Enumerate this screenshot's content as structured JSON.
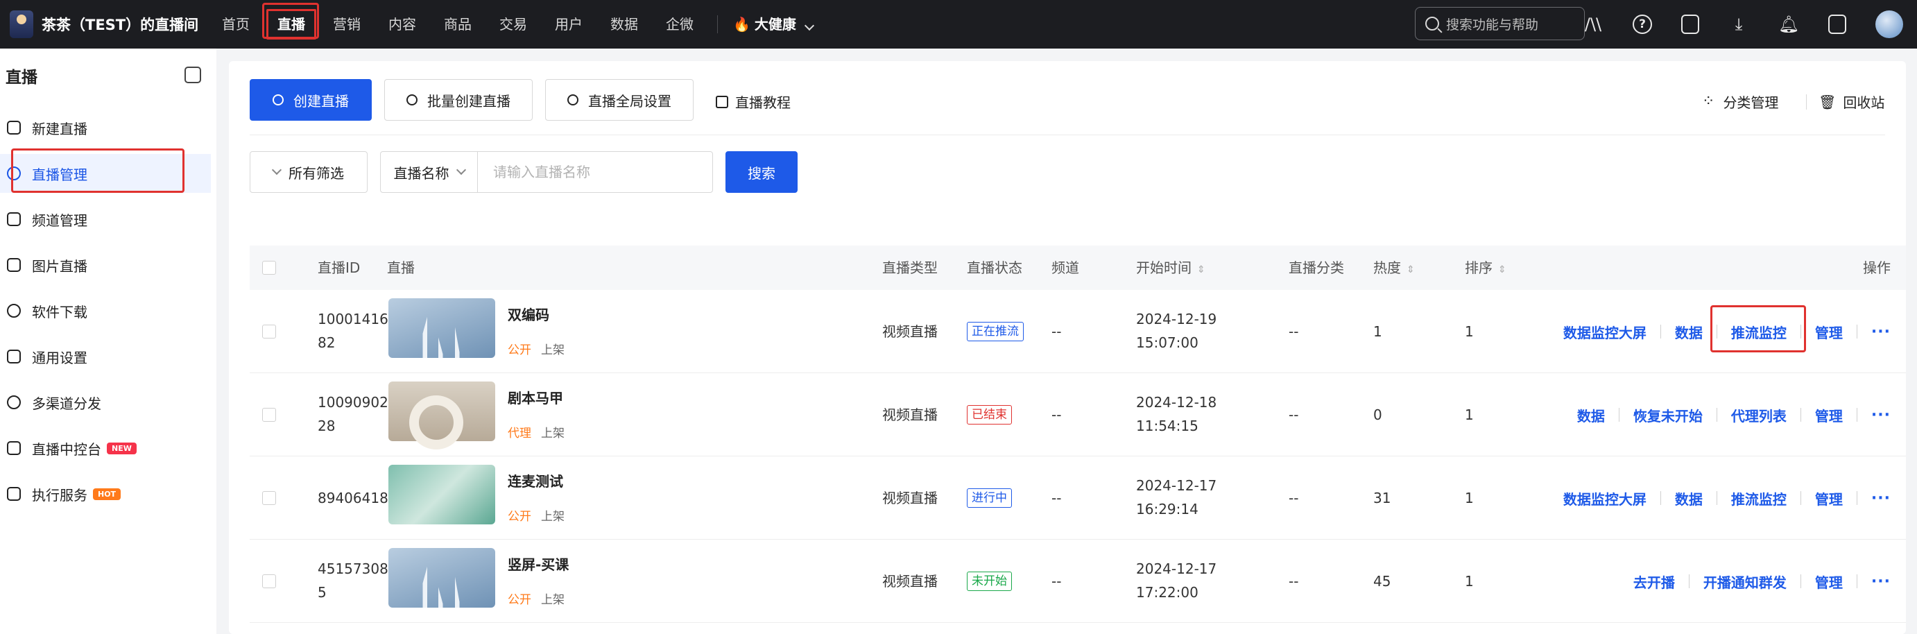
{
  "app": {
    "name": "茶茶（TEST）的直播间"
  },
  "nav": {
    "items": [
      "首页",
      "直播",
      "营销",
      "内容",
      "商品",
      "交易",
      "用户",
      "数据",
      "企微"
    ],
    "active": "直播",
    "health_label": "大健康"
  },
  "top_search": {
    "placeholder": "搜索功能与帮助"
  },
  "top_icons": [
    "ai-icon",
    "help-icon",
    "notes-icon",
    "download-icon",
    "bell-icon",
    "exit-icon",
    "avatar"
  ],
  "sidebar": {
    "title": "直播",
    "items": [
      {
        "label": "新建直播",
        "icon": "new-live-icon"
      },
      {
        "label": "直播管理",
        "icon": "manage-icon",
        "active": true
      },
      {
        "label": "频道管理",
        "icon": "channel-icon"
      },
      {
        "label": "图片直播",
        "icon": "image-icon"
      },
      {
        "label": "软件下载",
        "icon": "download-icon"
      },
      {
        "label": "通用设置",
        "icon": "settings-icon"
      },
      {
        "label": "多渠道分发",
        "icon": "share-icon"
      },
      {
        "label": "直播中控台",
        "icon": "console-icon",
        "badge": "NEW"
      },
      {
        "label": "执行服务",
        "icon": "service-icon",
        "badge": "HOT"
      }
    ]
  },
  "toolbar": {
    "create_label": "创建直播",
    "batch_create_label": "批量创建直播",
    "global_settings_label": "直播全局设置",
    "tutorial_label": "直播教程",
    "category_label": "分类管理",
    "recycle_label": "回收站"
  },
  "filters": {
    "all_filters_label": "所有筛选",
    "field_label": "直播名称",
    "field_placeholder": "请输入直播名称",
    "search_label": "搜索"
  },
  "table": {
    "columns": {
      "id": "直播ID",
      "live": "直播",
      "type": "直播类型",
      "status": "直播状态",
      "channel": "频道",
      "start": "开始时间",
      "category": "直播分类",
      "heat": "热度",
      "order": "排序",
      "ops": "操作"
    },
    "rows": [
      {
        "id_line1": "10001416",
        "id_line2": "82",
        "title": "双编码",
        "visibility": "公开",
        "shelf": "上架",
        "type": "视频直播",
        "status": "正在推流",
        "status_color": "blue",
        "channel": "--",
        "date": "2024-12-19",
        "time": "15:07:00",
        "category": "--",
        "heat": "1",
        "order": "1",
        "ops": [
          "数据监控大屏",
          "数据",
          "推流监控",
          "管理"
        ]
      },
      {
        "id_line1": "10090902",
        "id_line2": "28",
        "title": "剧本马甲",
        "visibility": "代理",
        "shelf": "上架",
        "type": "视频直播",
        "status": "已结束",
        "status_color": "red",
        "channel": "--",
        "date": "2024-12-18",
        "time": "11:54:15",
        "category": "--",
        "heat": "0",
        "order": "1",
        "ops": [
          "数据",
          "恢复未开始",
          "代理列表",
          "管理"
        ]
      },
      {
        "id_line1": "89406418",
        "id_line2": "",
        "title": "连麦测试",
        "visibility": "公开",
        "shelf": "上架",
        "type": "视频直播",
        "status": "进行中",
        "status_color": "blue",
        "channel": "--",
        "date": "2024-12-17",
        "time": "16:29:14",
        "category": "--",
        "heat": "31",
        "order": "1",
        "ops": [
          "数据监控大屏",
          "数据",
          "推流监控",
          "管理"
        ]
      },
      {
        "id_line1": "45157308",
        "id_line2": "5",
        "title": "竖屏-买课",
        "visibility": "公开",
        "shelf": "上架",
        "type": "视频直播",
        "status": "未开始",
        "status_color": "green",
        "channel": "--",
        "date": "2024-12-17",
        "time": "17:22:00",
        "category": "--",
        "heat": "45",
        "order": "1",
        "ops": [
          "去开播",
          "开播通知群发",
          "管理"
        ]
      }
    ],
    "more_label": "···"
  },
  "colors": {
    "accent": "#1e5ae8",
    "highlight": "#e0322f",
    "topbar": "#1c1d21"
  }
}
